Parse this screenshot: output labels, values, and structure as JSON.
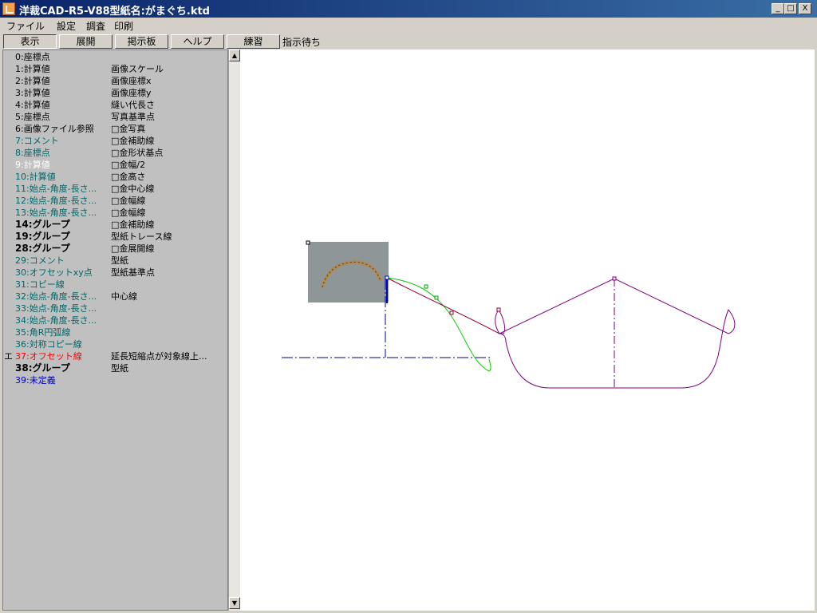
{
  "window": {
    "title": "洋裁CAD-R5-V88型紙名:がまぐち.ktd",
    "minimize": "_",
    "maximize": "□",
    "close": "X"
  },
  "menu": [
    "ファイル",
    "設定",
    "調査",
    "印刷"
  ],
  "toolbar": {
    "buttons": [
      "表示",
      "展開",
      "掲示板",
      "ヘルプ",
      "練習"
    ],
    "status": "指示待ち"
  },
  "items": [
    {
      "main": "0:座標点",
      "sub": "",
      "color": "#000000",
      "bold": false
    },
    {
      "main": "1:計算値",
      "sub": "画像スケール",
      "color": "#000000",
      "bold": false
    },
    {
      "main": "2:計算値",
      "sub": "画像座標x",
      "color": "#000000",
      "bold": false
    },
    {
      "main": "3:計算値",
      "sub": "画像座標y",
      "color": "#000000",
      "bold": false
    },
    {
      "main": "4:計算値",
      "sub": "縫い代長さ",
      "color": "#000000",
      "bold": false
    },
    {
      "main": "5:座標点",
      "sub": "写真基準点",
      "color": "#000000",
      "bold": false
    },
    {
      "main": "6:画像ファイル参照",
      "sub": "□金写真",
      "color": "#000000",
      "bold": false
    },
    {
      "main": "7:コメント",
      "sub": "□金補助線",
      "color": "#006666",
      "bold": false
    },
    {
      "main": "8:座標点",
      "sub": "□金形状基点",
      "color": "#006666",
      "bold": false
    },
    {
      "main": "9:計算値",
      "sub": "□金幅/2",
      "color": "#ffffff",
      "bold": false
    },
    {
      "main": "10:計算値",
      "sub": "□金高さ",
      "color": "#006666",
      "bold": false
    },
    {
      "main": "11:始点-角度-長さ...",
      "sub": "□金中心線",
      "color": "#006666",
      "bold": false
    },
    {
      "main": "12:始点-角度-長さ...",
      "sub": "□金幅線",
      "color": "#006666",
      "bold": false
    },
    {
      "main": "13:始点-角度-長さ...",
      "sub": "□金幅線",
      "color": "#006666",
      "bold": false
    },
    {
      "main": "14:グループ",
      "sub": "□金補助線",
      "color": "#000000",
      "bold": true
    },
    {
      "main": "19:グループ",
      "sub": "型紙トレース線",
      "color": "#000000",
      "bold": true
    },
    {
      "main": "28:グループ",
      "sub": "□金展開線",
      "color": "#000000",
      "bold": true
    },
    {
      "main": "29:コメント",
      "sub": "型紙",
      "color": "#006666",
      "bold": false
    },
    {
      "main": "30:オフセットxy点",
      "sub": "型紙基準点",
      "color": "#006666",
      "bold": false
    },
    {
      "main": "31:コピー線",
      "sub": "",
      "color": "#006666",
      "bold": false
    },
    {
      "main": "32:始点-角度-長さ...",
      "sub": "中心線",
      "color": "#006666",
      "bold": false
    },
    {
      "main": "33:始点-角度-長さ...",
      "sub": "",
      "color": "#006666",
      "bold": false
    },
    {
      "main": "34:始点-角度-長さ...",
      "sub": "",
      "color": "#006666",
      "bold": false
    },
    {
      "main": "35:角R円弧線",
      "sub": "",
      "color": "#006666",
      "bold": false
    },
    {
      "main": "36:対称コピー線",
      "sub": "",
      "color": "#006666",
      "bold": false
    },
    {
      "main": "37:オフセット線",
      "sub": "延長短縮点が対象線上...",
      "color": "#ff0000",
      "bold": false,
      "marker": "エ"
    },
    {
      "main": "38:グループ",
      "sub": "型紙",
      "color": "#000000",
      "bold": true
    },
    {
      "main": "39:未定義",
      "sub": "",
      "color": "#0000cc",
      "bold": false
    }
  ],
  "scroll": {
    "up": "▲",
    "down": "▼"
  }
}
